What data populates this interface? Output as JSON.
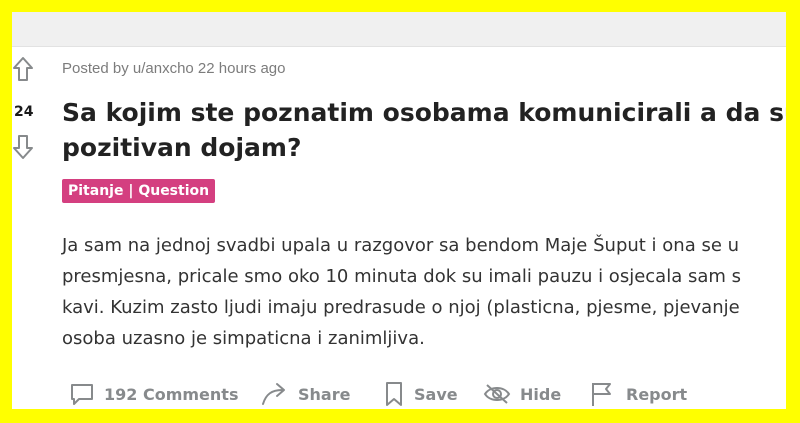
{
  "post": {
    "score": "24",
    "meta": "Posted by u/anxcho 22 hours ago",
    "title_lines": [
      "Sa kojim ste poznatim osobama komunicirali a da su m",
      "pozitivan dojam?"
    ],
    "flair": "Pitanje | Question",
    "body_lines": [
      "Ja sam na jednoj svadbi upala u razgovor sa bendom Maje Šuput i ona se u",
      "presmjesna, pricale smo oko 10 minuta dok su imali pauzu i osjecala sam s",
      "kavi. Kuzim zasto ljudi imaju predrasude o njoj (plasticna, pjesme, pjevanje",
      "osoba uzasno je simpaticna i zanimljiva."
    ]
  },
  "actions": {
    "comments": "192 Comments",
    "share": "Share",
    "save": "Save",
    "hide": "Hide",
    "report": "Report"
  },
  "icons": [
    "upvote-icon",
    "downvote-icon",
    "comment-icon",
    "share-icon",
    "save-icon",
    "hide-icon",
    "report-icon"
  ],
  "colors": {
    "frame": "#ffff00",
    "flair_bg": "#d43f80",
    "action_text": "#878a8c"
  }
}
